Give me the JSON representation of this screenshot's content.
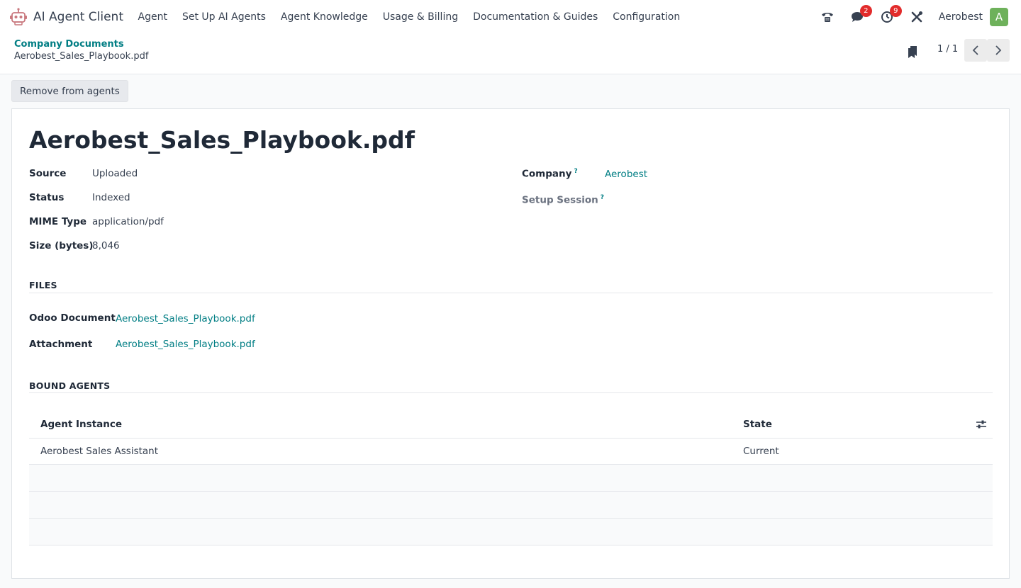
{
  "navbar": {
    "app_name": "AI Agent Client",
    "menu": [
      "Agent",
      "Set Up AI Agents",
      "Agent Knowledge",
      "Usage & Billing",
      "Documentation & Guides",
      "Configuration"
    ],
    "messages_count": "2",
    "activities_count": "9",
    "company": "Aerobest",
    "avatar_initial": "A",
    "avatar_color": "#6eb15b"
  },
  "breadcrumb": {
    "parent": "Company Documents",
    "current": "Aerobest_Sales_Playbook.pdf"
  },
  "pager": {
    "value": "1 / 1"
  },
  "actions": {
    "remove_label": "Remove from agents"
  },
  "record": {
    "title": "Aerobest_Sales_Playbook.pdf",
    "fields_left": [
      {
        "label": "Source",
        "value": "Uploaded"
      },
      {
        "label": "Status",
        "value": "Indexed"
      },
      {
        "label": "MIME Type",
        "value": "application/pdf"
      },
      {
        "label": "Size (bytes)",
        "value": "8,046"
      }
    ],
    "company_label": "Company",
    "company_value": "Aerobest",
    "setup_session_label": "Setup Session",
    "help_mark": "?"
  },
  "files": {
    "title": "FILES",
    "odoo_document_label": "Odoo Document",
    "odoo_document_value": "Aerobest_Sales_Playbook.pdf",
    "attachment_label": "Attachment",
    "attachment_value": "Aerobest_Sales_Playbook.pdf"
  },
  "bound_agents": {
    "title": "BOUND AGENTS",
    "columns": [
      "Agent Instance",
      "State"
    ],
    "rows": [
      {
        "agent_instance": "Aerobest Sales Assistant",
        "state": "Current"
      }
    ]
  },
  "colors": {
    "link": "#017e84",
    "badge": "#e22b2b"
  }
}
